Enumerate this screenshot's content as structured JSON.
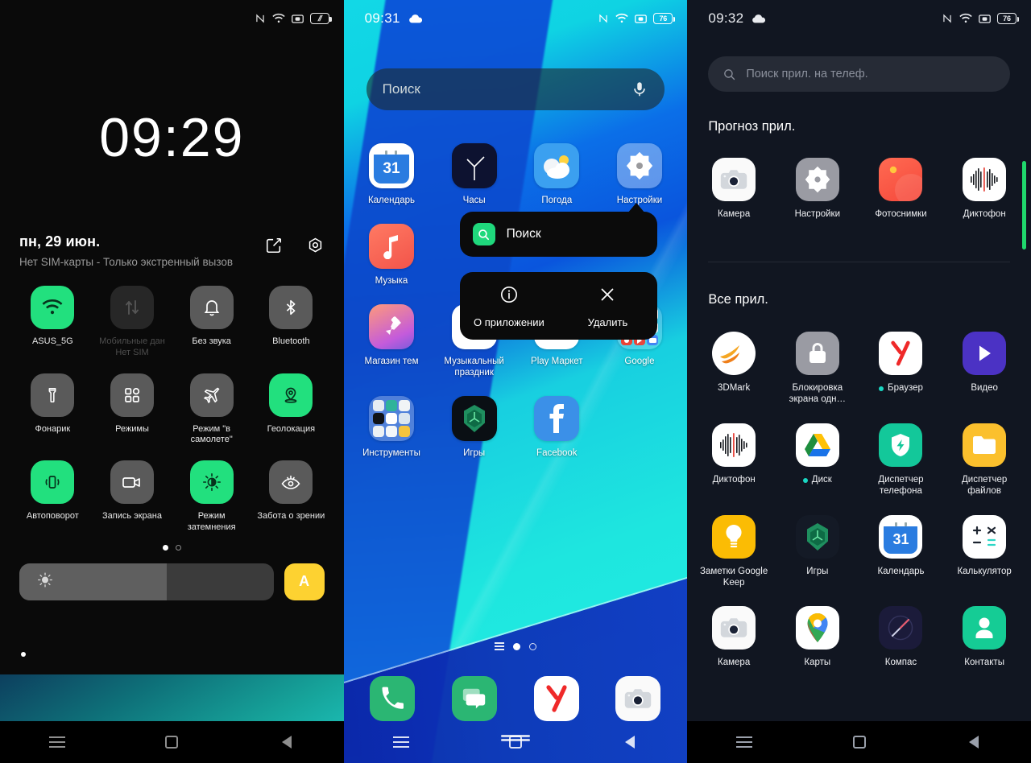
{
  "panels": {
    "lock": {
      "status": {
        "time": "",
        "battery_label": "charging",
        "icons": [
          "nfc-icon",
          "wifi-icon",
          "cast-icon",
          "battery-charging-icon"
        ]
      },
      "clock": "09:29",
      "date": "пн, 29 июн.",
      "sim_status": "Нет SIM-карты - Только экстренный вызов",
      "actions": [
        "edit-icon",
        "settings-icon"
      ],
      "tiles": [
        {
          "label": "ASUS_5G",
          "icon": "wifi-icon",
          "state": "on"
        },
        {
          "label": "Мобильные дан\nНет SIM",
          "icon": "mobile-data-icon",
          "state": "disabled"
        },
        {
          "label": "Без звука",
          "icon": "bell-mute-icon",
          "state": "off"
        },
        {
          "label": "Bluetooth",
          "icon": "bluetooth-icon",
          "state": "off"
        },
        {
          "label": "Фонарик",
          "icon": "flashlight-icon",
          "state": "off"
        },
        {
          "label": "Режимы",
          "icon": "modes-grid-icon",
          "state": "off"
        },
        {
          "label": "Режим \"в самолете\"",
          "icon": "airplane-icon",
          "state": "off"
        },
        {
          "label": "Геолокация",
          "icon": "location-pin-icon",
          "state": "on"
        },
        {
          "label": "Автоповорот",
          "icon": "auto-rotate-icon",
          "state": "on"
        },
        {
          "label": "Запись экрана",
          "icon": "screen-record-icon",
          "state": "off"
        },
        {
          "label": "Режим затемнения",
          "icon": "dark-mode-icon",
          "state": "on"
        },
        {
          "label": "Забота о зрении",
          "icon": "eye-care-icon",
          "state": "off"
        }
      ],
      "page_dots": {
        "count": 2,
        "active": 0
      },
      "brightness": {
        "icon": "brightness-sun-icon",
        "value_percent": 58,
        "auto_label": "A"
      }
    },
    "home": {
      "status": {
        "time": "09:31",
        "weather_icon": "cloud-icon",
        "battery_label": "76"
      },
      "search": {
        "placeholder": "Поиск",
        "mic_icon": "microphone-icon"
      },
      "apps": [
        {
          "label": "Календарь",
          "icon": "calendar-icon",
          "badge": "31"
        },
        {
          "label": "Часы",
          "icon": "clock-icon"
        },
        {
          "label": "Погода",
          "icon": "weather-icon"
        },
        {
          "label": "Настройки",
          "icon": "settings-gear-icon",
          "selected": true
        },
        {
          "label": "Музыка",
          "icon": "music-note-icon"
        },
        {
          "label": "",
          "icon": "hidden-icon"
        },
        {
          "label": "",
          "icon": "hidden-icon"
        },
        {
          "label": "",
          "icon": "hidden-icon"
        },
        {
          "label": "Магазин тем",
          "icon": "theme-store-icon"
        },
        {
          "label": "Музыкальный праздник",
          "icon": "music-party-icon"
        },
        {
          "label": "Play Маркет",
          "icon": "play-store-icon"
        },
        {
          "label": "Google",
          "icon": "google-folder-icon"
        },
        {
          "label": "Инструменты",
          "icon": "tools-folder-icon"
        },
        {
          "label": "Игры",
          "icon": "games-icon"
        },
        {
          "label": "Facebook",
          "icon": "facebook-icon"
        }
      ],
      "context_menu": {
        "app_name": "Поиск",
        "app_icon": "search-green-icon",
        "items": [
          {
            "label": "О приложении",
            "icon": "info-icon"
          },
          {
            "label": "Удалить",
            "icon": "close-x-icon"
          }
        ]
      },
      "page_dots": {
        "count": 2,
        "active": 0
      },
      "dock": [
        {
          "label": "Телефон",
          "icon": "phone-icon"
        },
        {
          "label": "Сообщения",
          "icon": "messages-icon"
        },
        {
          "label": "Яндекс",
          "icon": "yandex-icon"
        },
        {
          "label": "Камера",
          "icon": "camera-icon"
        }
      ]
    },
    "drawer": {
      "status": {
        "time": "09:32",
        "weather_icon": "cloud-icon",
        "battery_label": "76"
      },
      "search": {
        "placeholder": "Поиск прил. на телеф.",
        "icon": "search-icon"
      },
      "sections": [
        {
          "title": "Прогноз прил.",
          "apps": [
            {
              "label": "Камера",
              "icon": "camera-icon"
            },
            {
              "label": "Настройки",
              "icon": "settings-gear-icon"
            },
            {
              "label": "Фотоснимки",
              "icon": "photos-icon"
            },
            {
              "label": "Диктофон",
              "icon": "recorder-icon"
            }
          ]
        },
        {
          "title": "Все прил.",
          "apps": [
            {
              "label": "3DMark",
              "icon": "3dmark-icon"
            },
            {
              "label": "Блокировка экрана одн…",
              "icon": "lock-icon"
            },
            {
              "label": "Браузер",
              "icon": "yandex-browser-icon",
              "new": true
            },
            {
              "label": "Видео",
              "icon": "video-icon"
            },
            {
              "label": "Диктофон",
              "icon": "recorder-icon"
            },
            {
              "label": "Диск",
              "icon": "google-drive-icon",
              "new": true
            },
            {
              "label": "Диспетчер телефона",
              "icon": "phone-manager-icon"
            },
            {
              "label": "Диспетчер файлов",
              "icon": "file-manager-icon"
            },
            {
              "label": "Заметки Google Keep",
              "icon": "keep-icon"
            },
            {
              "label": "Игры",
              "icon": "games-icon"
            },
            {
              "label": "Календарь",
              "icon": "calendar-icon",
              "badge": "31"
            },
            {
              "label": "Калькулятор",
              "icon": "calculator-icon"
            },
            {
              "label": "Камера",
              "icon": "camera-icon"
            },
            {
              "label": "Карты",
              "icon": "maps-icon"
            },
            {
              "label": "Компас",
              "icon": "compass-icon"
            },
            {
              "label": "Контакты",
              "icon": "contacts-icon"
            }
          ]
        }
      ],
      "scrollbar": {
        "color": "#1fd86c"
      }
    }
  },
  "navbar": {
    "items": [
      {
        "name": "recents-button",
        "icon": "menu-lines-icon"
      },
      {
        "name": "home-button",
        "icon": "square-icon"
      },
      {
        "name": "back-button",
        "icon": "triangle-back-icon"
      }
    ]
  },
  "colors": {
    "accent_green": "#22e07e",
    "drawer_bg": "#111621",
    "lock_bg": "#0a0a0a",
    "auto_brightness": "#fdd231",
    "new_dot": "#1ad6c2"
  }
}
